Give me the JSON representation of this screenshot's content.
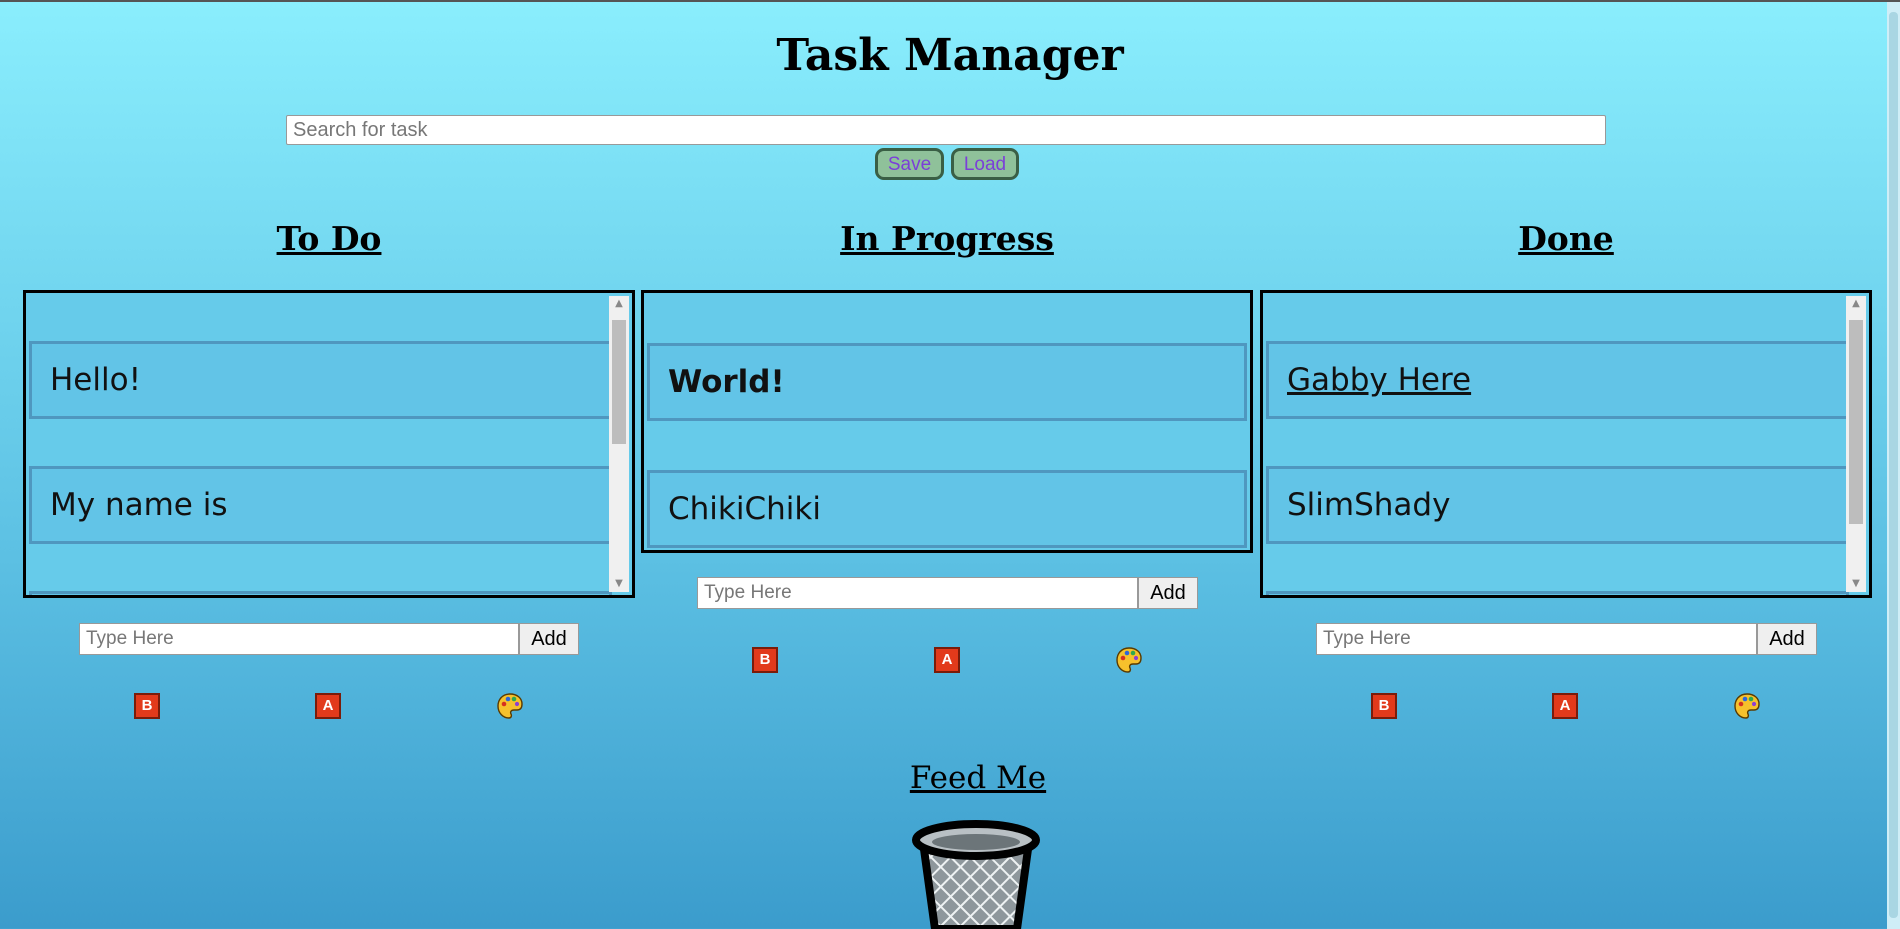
{
  "app": {
    "title": "Task Manager",
    "search": {
      "placeholder": "Search for task",
      "value": ""
    },
    "save_label": "Save",
    "load_label": "Load"
  },
  "columns": [
    {
      "title": "To Do",
      "items": [
        {
          "text": "Hello!",
          "style": "normal"
        },
        {
          "text": "My name is",
          "style": "normal"
        }
      ],
      "input": {
        "placeholder": "Type Here",
        "value": ""
      },
      "add_label": "Add",
      "tools": {
        "bold_label": "B",
        "color_label": "A",
        "palette_icon": "palette-icon"
      }
    },
    {
      "title": "In Progress",
      "items": [
        {
          "text": "World!",
          "style": "bold"
        },
        {
          "text": "ChikiChiki",
          "style": "normal"
        }
      ],
      "input": {
        "placeholder": "Type Here",
        "value": ""
      },
      "add_label": "Add",
      "tools": {
        "bold_label": "B",
        "color_label": "A",
        "palette_icon": "palette-icon"
      }
    },
    {
      "title": "Done",
      "items": [
        {
          "text": "Gabby Here",
          "style": "underline"
        },
        {
          "text": "SlimShady",
          "style": "normal"
        }
      ],
      "input": {
        "placeholder": "Type Here",
        "value": ""
      },
      "add_label": "Add",
      "tools": {
        "bold_label": "B",
        "color_label": "A",
        "palette_icon": "palette-icon"
      }
    }
  ],
  "trash": {
    "label": "Feed Me",
    "icon": "trash-can-icon"
  },
  "colors": {
    "accent_button": "#8fc19a",
    "button_text": "#7b3fd8",
    "tool_red": "#e23a1b",
    "list_bg": "#66cbea"
  }
}
